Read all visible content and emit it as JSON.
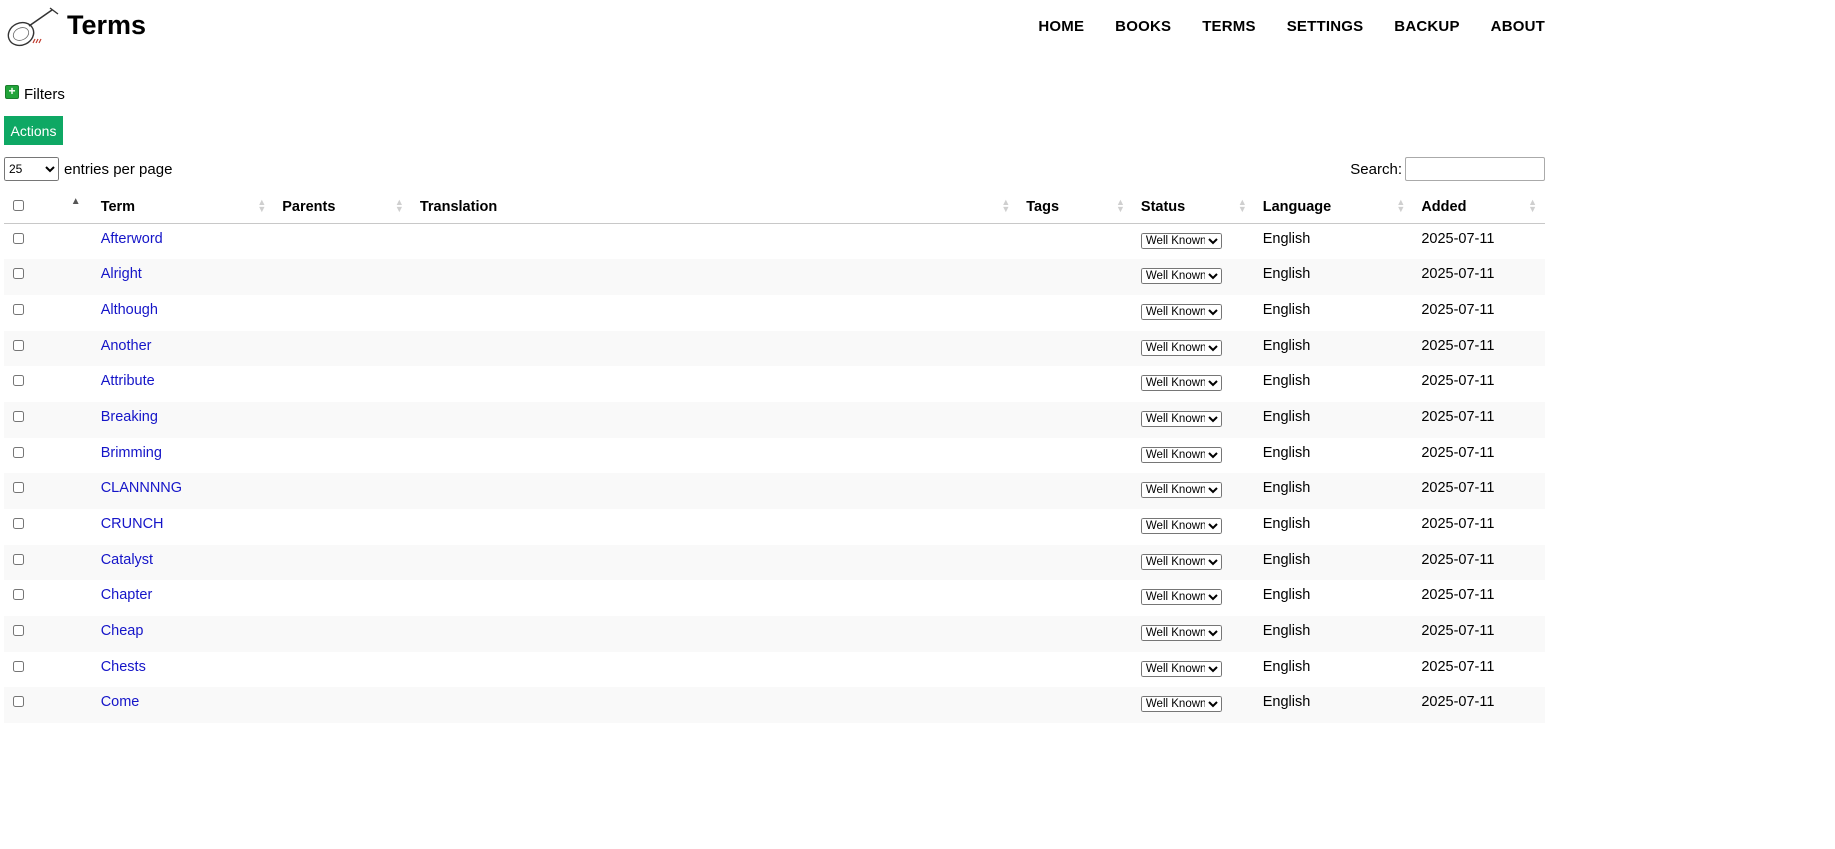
{
  "header": {
    "title": "Terms",
    "nav": [
      "HOME",
      "BOOKS",
      "TERMS",
      "SETTINGS",
      "BACKUP",
      "ABOUT"
    ]
  },
  "filters": {
    "label": "Filters"
  },
  "actions": {
    "label": "Actions"
  },
  "entries": {
    "value": "25",
    "label": "entries per page"
  },
  "search": {
    "label": "Search:",
    "value": ""
  },
  "table": {
    "columns": [
      "Term",
      "Parents",
      "Translation",
      "Tags",
      "Status",
      "Language",
      "Added"
    ],
    "rows": [
      {
        "term": "Afterword",
        "parents": "",
        "translation": "",
        "tags": "",
        "status": "Well Known",
        "language": "English",
        "added": "2025-07-11"
      },
      {
        "term": "Alright",
        "parents": "",
        "translation": "",
        "tags": "",
        "status": "Well Known",
        "language": "English",
        "added": "2025-07-11"
      },
      {
        "term": "Although",
        "parents": "",
        "translation": "",
        "tags": "",
        "status": "Well Known",
        "language": "English",
        "added": "2025-07-11"
      },
      {
        "term": "Another",
        "parents": "",
        "translation": "",
        "tags": "",
        "status": "Well Known",
        "language": "English",
        "added": "2025-07-11"
      },
      {
        "term": "Attribute",
        "parents": "",
        "translation": "",
        "tags": "",
        "status": "Well Known",
        "language": "English",
        "added": "2025-07-11"
      },
      {
        "term": "Breaking",
        "parents": "",
        "translation": "",
        "tags": "",
        "status": "Well Known",
        "language": "English",
        "added": "2025-07-11"
      },
      {
        "term": "Brimming",
        "parents": "",
        "translation": "",
        "tags": "",
        "status": "Well Known",
        "language": "English",
        "added": "2025-07-11"
      },
      {
        "term": "CLANNNNG",
        "parents": "",
        "translation": "",
        "tags": "",
        "status": "Well Known",
        "language": "English",
        "added": "2025-07-11"
      },
      {
        "term": "CRUNCH",
        "parents": "",
        "translation": "",
        "tags": "",
        "status": "Well Known",
        "language": "English",
        "added": "2025-07-11"
      },
      {
        "term": "Catalyst",
        "parents": "",
        "translation": "",
        "tags": "",
        "status": "Well Known",
        "language": "English",
        "added": "2025-07-11"
      },
      {
        "term": "Chapter",
        "parents": "",
        "translation": "",
        "tags": "",
        "status": "Well Known",
        "language": "English",
        "added": "2025-07-11"
      },
      {
        "term": "Cheap",
        "parents": "",
        "translation": "",
        "tags": "",
        "status": "Well Known",
        "language": "English",
        "added": "2025-07-11"
      },
      {
        "term": "Chests",
        "parents": "",
        "translation": "",
        "tags": "",
        "status": "Well Known",
        "language": "English",
        "added": "2025-07-11"
      },
      {
        "term": "Come",
        "parents": "",
        "translation": "",
        "tags": "",
        "status": "Well Known",
        "language": "English",
        "added": "2025-07-11"
      }
    ]
  },
  "icons": {
    "logo": "lute-logo",
    "filters": "plus-icon",
    "sort": "sort-arrows-icon"
  },
  "colors": {
    "link": "#1515c8",
    "actions_bg": "#0ea864",
    "plus_bg": "#22a43a"
  }
}
